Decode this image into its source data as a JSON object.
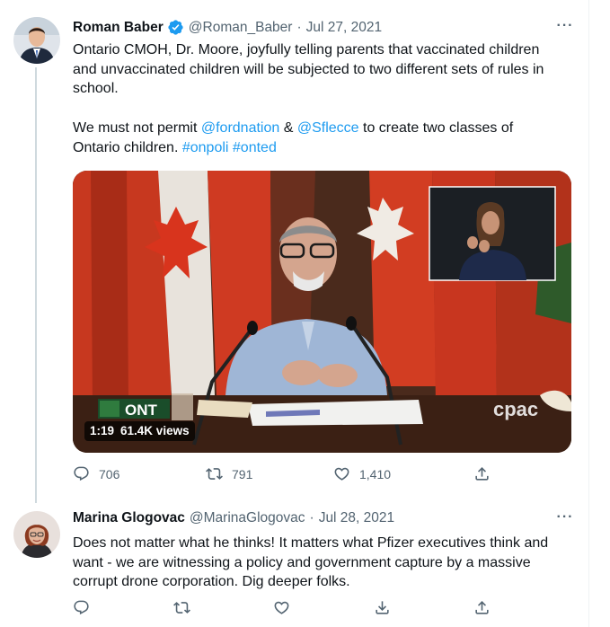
{
  "tweets": [
    {
      "author": {
        "name": "Roman Baber",
        "handle": "@Roman_Baber",
        "verified": true
      },
      "date": "Jul 27, 2021",
      "text_lines": [
        "Ontario CMOH, Dr. Moore, joyfully telling parents that vaccinated children",
        "and unvaccinated children will be subjected to two different sets of rules in",
        "school."
      ],
      "text2": {
        "prefix": "We must not permit ",
        "mention1": "@fordnation",
        "amp": " & ",
        "mention2": "@Sflecce",
        "suffix": " to create two classes of",
        "line2": "Ontario children. ",
        "hashtag1": "#onpoli",
        "hashtag2": "#onted"
      },
      "video": {
        "duration": "1:19",
        "views": "61.4K views",
        "watermark": "cpac",
        "logo": "ONT"
      },
      "stats": {
        "replies": "706",
        "retweets": "791",
        "likes": "1,410"
      }
    },
    {
      "author": {
        "name": "Marina Glogovac",
        "handle": "@MarinaGlogovac"
      },
      "date": "Jul 28, 2021",
      "text_lines": [
        "Does not matter what he thinks! It matters what Pfizer executives think and",
        "want - we are witnessing a policy and government capture by a massive",
        "corrupt drone corporation. Dig deeper folks."
      ]
    }
  ],
  "ui": {
    "dot": "·",
    "more": "···"
  },
  "colors": {
    "accent": "#1d9bf0",
    "muted": "#536471",
    "text": "#0f1419",
    "verified": "#1d9bf0"
  },
  "icons": [
    "verified-badge-icon",
    "more-icon",
    "reply-icon",
    "retweet-icon",
    "like-icon",
    "share-icon",
    "upload-icon"
  ]
}
